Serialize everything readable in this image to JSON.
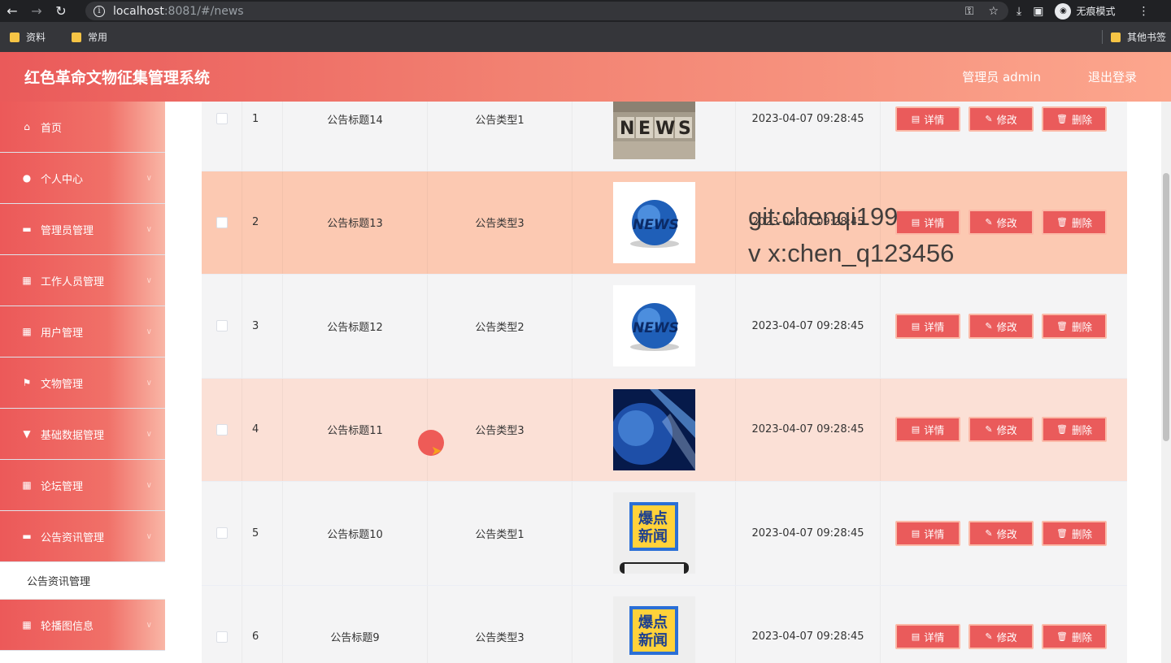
{
  "browser": {
    "url_host": "localhost",
    "url_path": ":8081/#/news",
    "incognito_label": "无痕模式",
    "bookmarks": [
      "资料",
      "常用"
    ],
    "other_bookmarks": "其他书签"
  },
  "header": {
    "title": "红色革命文物征集管理系统",
    "user": "管理员 admin",
    "logout": "退出登录"
  },
  "sidebar": {
    "items": [
      {
        "label": "首页",
        "icon": "home-icon",
        "glyph": "⌂"
      },
      {
        "label": "个人中心",
        "icon": "user-icon",
        "glyph": "●"
      },
      {
        "label": "管理员管理",
        "icon": "briefcase-icon",
        "glyph": "▬"
      },
      {
        "label": "工作人员管理",
        "icon": "grid-icon",
        "glyph": "▦"
      },
      {
        "label": "用户管理",
        "icon": "grid-icon",
        "glyph": "▦"
      },
      {
        "label": "文物管理",
        "icon": "flag-icon",
        "glyph": "⚑"
      },
      {
        "label": "基础数据管理",
        "icon": "cup-icon",
        "glyph": "▼"
      },
      {
        "label": "论坛管理",
        "icon": "grid-icon",
        "glyph": "▦"
      },
      {
        "label": "公告资讯管理",
        "icon": "box-icon",
        "glyph": "▬"
      },
      {
        "label": "轮播图信息",
        "icon": "grid-icon",
        "glyph": "▦"
      }
    ],
    "active_sub": "公告资讯管理"
  },
  "table": {
    "rows": [
      {
        "index": "1",
        "title": "公告标题14",
        "type": "公告类型1",
        "time": "2023-04-07 09:28:45",
        "image": "news-blocks"
      },
      {
        "index": "2",
        "title": "公告标题13",
        "type": "公告类型3",
        "time": "2023-04-07 09:28:45",
        "image": "news-globe"
      },
      {
        "index": "3",
        "title": "公告标题12",
        "type": "公告类型2",
        "time": "2023-04-07 09:28:45",
        "image": "news-globe"
      },
      {
        "index": "4",
        "title": "公告标题11",
        "type": "公告类型3",
        "time": "2023-04-07 09:28:45",
        "image": "blue-globe"
      },
      {
        "index": "5",
        "title": "公告标题10",
        "type": "公告类型1",
        "time": "2023-04-07 09:28:45",
        "image": "breaking-news"
      },
      {
        "index": "6",
        "title": "公告标题9",
        "type": "公告类型3",
        "time": "2023-04-07 09:28:45",
        "image": "breaking-news"
      }
    ],
    "actions": {
      "detail": "详情",
      "edit": "修改",
      "delete": "删除"
    }
  },
  "watermark": {
    "line1": "git:chenqi199",
    "line2": "v x:chen_q123456"
  },
  "colors": {
    "accent": "#ea5b5b",
    "header_end": "#fca68d",
    "row_highlight": "#fcc9b2"
  }
}
